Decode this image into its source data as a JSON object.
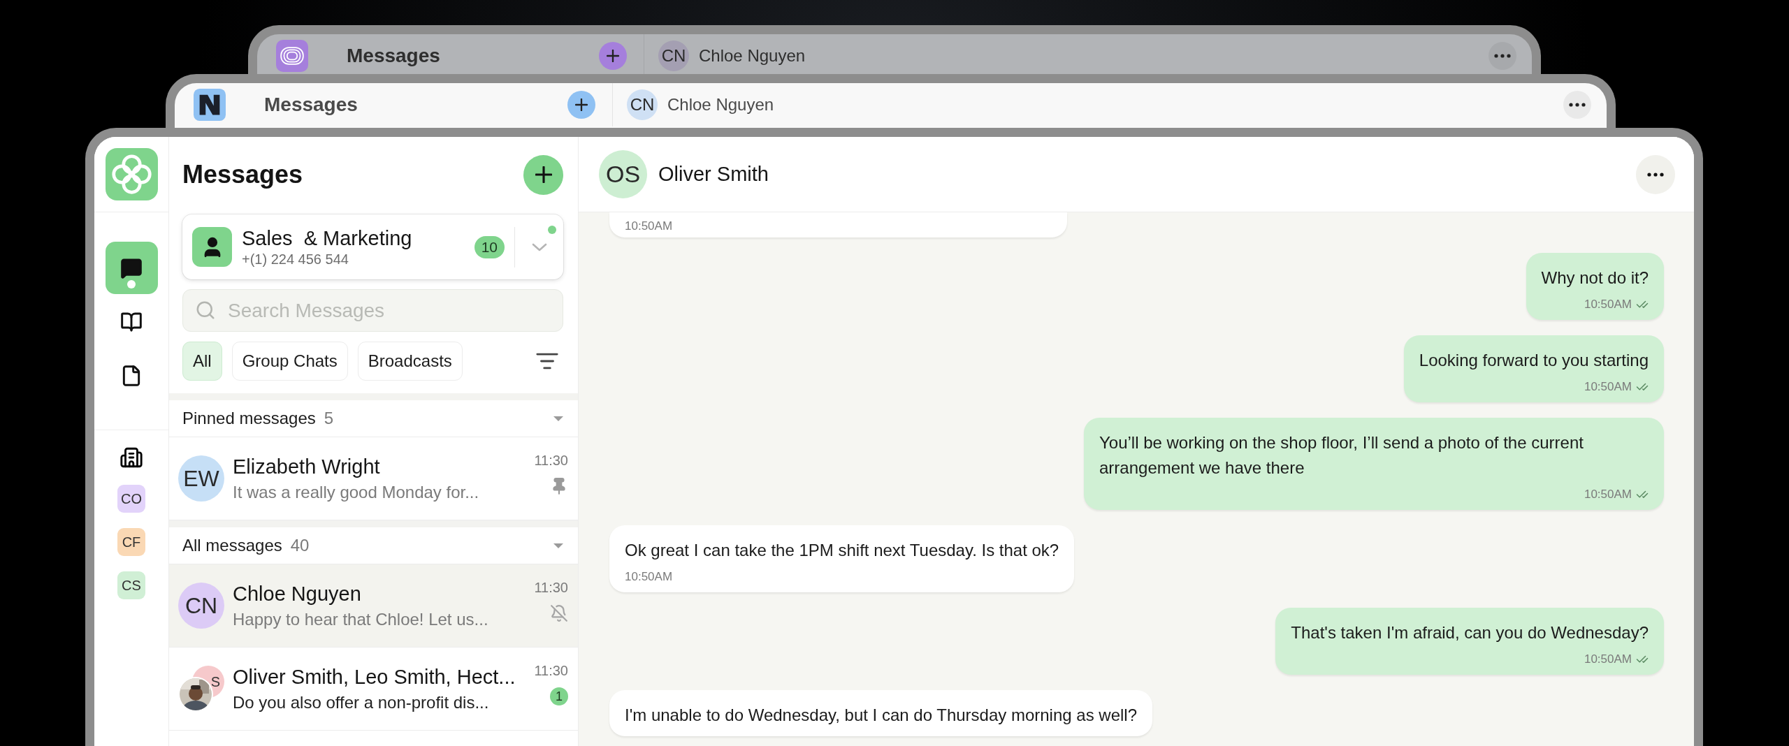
{
  "back_windows": [
    {
      "kind": "rings",
      "title": "Messages",
      "contact_initials": "CN",
      "contact_name": "Chloe Nguyen",
      "color": "#a57fdc"
    },
    {
      "kind": "block",
      "title": "Messages",
      "contact_initials": "CN",
      "contact_name": "Chloe Nguyen",
      "color": "#8fc1f3"
    }
  ],
  "window": {
    "rail": {
      "nav": [
        {
          "selected": true,
          "unread": true
        },
        {
          "selected": false,
          "unread": false
        },
        {
          "selected": false,
          "unread": false
        }
      ],
      "workspaces": [
        {
          "label": "CO",
          "color": "#e2d3fa"
        },
        {
          "label": "CF",
          "color": "#fad8b4"
        },
        {
          "label": "CS",
          "color": "#d0efd5"
        }
      ]
    },
    "list": {
      "title": "Messages",
      "account": {
        "name": "Sales  & Marketing",
        "phone": "+(1) 224 456 544",
        "count": "10",
        "online": true
      },
      "search": {
        "placeholder": "Search Messages"
      },
      "filters": [
        {
          "label": "All",
          "selected": true
        },
        {
          "label": "Group Chats",
          "selected": false
        },
        {
          "label": "Broadcasts",
          "selected": false
        }
      ],
      "sections": [
        {
          "title": "Pinned messages",
          "count": "5",
          "conversations": [
            {
              "kind": "single",
              "initials": "EW",
              "color": "#c6dff6",
              "name": "Elizabeth Wright",
              "preview": "It was a really good Monday for...",
              "time": "11:30",
              "pinned": true,
              "muted": false,
              "selected": false
            }
          ]
        },
        {
          "title": "All messages",
          "count": "40",
          "conversations": [
            {
              "kind": "single",
              "initials": "CN",
              "color": "#dccbf6",
              "name": "Chloe Nguyen",
              "preview": "Happy to hear that Chloe! Let us...",
              "time": "11:30",
              "pinned": false,
              "muted": true,
              "selected": true
            },
            {
              "kind": "group",
              "initials": "S",
              "color": "#f6c9cb",
              "name": "Oliver Smith, Leo Smith, Hect...",
              "preview": "Do you also offer a non-profit dis...",
              "time": "11:30",
              "unread": "1",
              "pinned": false,
              "muted": false,
              "selected": false
            }
          ]
        }
      ]
    },
    "chat": {
      "contact": {
        "initials": "OS",
        "name": "Oliver Smith",
        "color": "#cdeed2"
      },
      "messages": [
        {
          "kind": "incoming",
          "time": "10:50AM",
          "read": false
        },
        {
          "kind": "outgoing",
          "text": "Why not do it?",
          "time": "10:50AM",
          "read": true
        },
        {
          "kind": "outgoing",
          "text": "Looking forward to you starting",
          "time": "10:50AM",
          "read": true
        },
        {
          "kind": "outgoing",
          "text": "You’ll be working on the shop floor, I’ll send a photo of the current arrangement we have there",
          "time": "10:50AM",
          "read": true
        },
        {
          "kind": "incoming",
          "text": "Ok great I can take the 1PM shift next Tuesday. Is that ok?",
          "time": "10:50AM",
          "read": false
        },
        {
          "kind": "outgoing",
          "text": "That's taken I'm afraid, can you do Wednesday?",
          "time": "10:50AM",
          "read": true
        },
        {
          "kind": "incoming",
          "text": "I'm unable to do Wednesday, but I can do Thursday morning as well?",
          "read": false
        }
      ]
    }
  }
}
